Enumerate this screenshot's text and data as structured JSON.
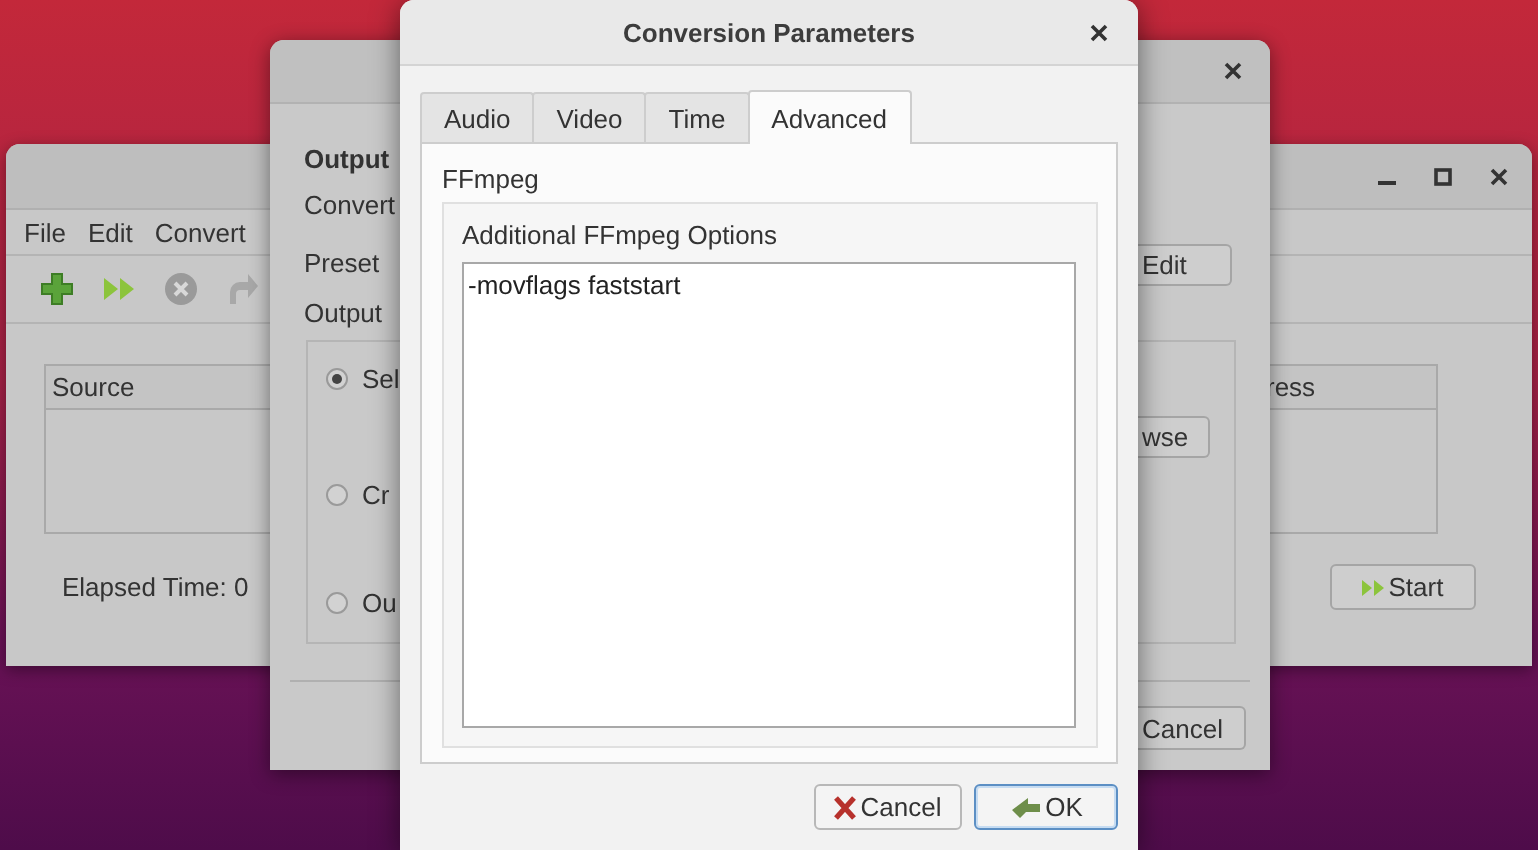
{
  "main_window": {
    "menu": [
      {
        "label": "File"
      },
      {
        "label": "Edit"
      },
      {
        "label": "Convert"
      }
    ],
    "table": {
      "columns": [
        "Source",
        "ress"
      ]
    },
    "elapsed": "Elapsed Time: 0",
    "start_button": "Start"
  },
  "output_dialog": {
    "heading": "Output",
    "rows": [
      "Convert",
      "Preset",
      "Output"
    ],
    "radios": [
      {
        "label": "Sel",
        "selected": true
      },
      {
        "label": "Cr",
        "selected": false
      },
      {
        "label": "Ou",
        "selected": false
      }
    ],
    "edit_button": "Edit",
    "browse_button": "wse",
    "cancel_button": "Cancel"
  },
  "params_dialog": {
    "title": "Conversion Parameters",
    "tabs": [
      {
        "label": "Audio",
        "selected": false
      },
      {
        "label": "Video",
        "selected": false
      },
      {
        "label": "Time",
        "selected": false
      },
      {
        "label": "Advanced",
        "selected": true
      }
    ],
    "section": "FFmpeg",
    "group_label": "Additional FFmpeg Options",
    "options_value": "-movflags faststart",
    "buttons": [
      {
        "label": "Cancel",
        "kind": "cancel",
        "focused": false
      },
      {
        "label": "OK",
        "kind": "ok",
        "focused": true
      }
    ]
  }
}
